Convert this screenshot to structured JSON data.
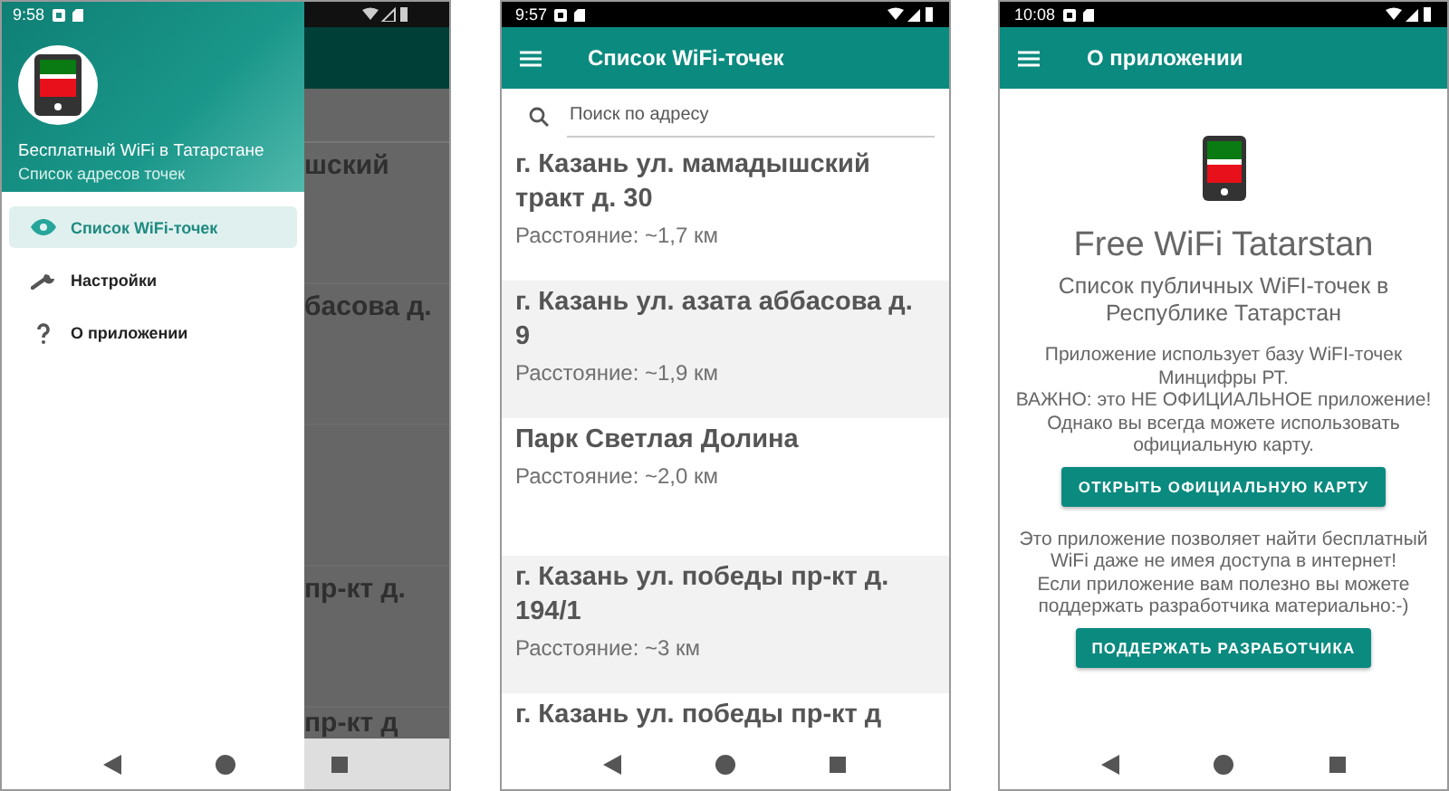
{
  "drawer_screen": {
    "status_time": "9:58",
    "drawer": {
      "title": "Бесплатный WiFi в Татарстане",
      "subtitle": "Список адресов точек",
      "items": [
        {
          "kind": "eye",
          "label": "Список WiFi-точек",
          "selected": true
        },
        {
          "kind": "wrench",
          "label": "Настройки",
          "selected": false
        },
        {
          "kind": "help",
          "label": "О приложении",
          "selected": false
        }
      ]
    },
    "background_fragments": [
      "шский",
      "басова д.",
      "пр-кт д.",
      "пр-кт д"
    ]
  },
  "list_screen": {
    "status_time": "9:57",
    "title": "Список WiFi-точек",
    "search": {
      "placeholder": "Поиск по адресу"
    },
    "items": [
      {
        "name": "г. Казань ул. мамадышский тракт д. 30",
        "distance": "Расстояние: ~1,7 км"
      },
      {
        "name": "г. Казань ул. азата аббасова д. 9",
        "distance": "Расстояние: ~1,9 км"
      },
      {
        "name": "Парк Светлая Долина",
        "distance": "Расстояние: ~2,0 км"
      },
      {
        "name": "г. Казань ул. победы пр-кт д. 194/1",
        "distance": "Расстояние: ~3 км"
      },
      {
        "name": "г. Казань ул. победы пр-кт д"
      }
    ]
  },
  "about_screen": {
    "status_time": "10:08",
    "title": "О приложении",
    "app_name": "Free WiFi Tatarstan",
    "subtitle": "Список публичных WiFI-точек в Республике Татарстан",
    "paragraphs_1": [
      "Приложение использует базу WiFI-точек Минцифры РТ.",
      "ВАЖНО: это НЕ ОФИЦИАЛЬНОЕ приложение!",
      "Однако вы всегда можете использовать официальную карту."
    ],
    "button_1": "ОТКРЫТЬ ОФИЦИАЛЬНУЮ КАРТУ",
    "paragraphs_2": [
      "Это приложение позволяет найти бесплатный WiFi даже не имея доступа в интернет!",
      "Если приложение вам полезно вы можете поддержать разработчика материально:-)"
    ],
    "button_2": "ПОДДЕРЖАТЬ РАЗРАБОТЧИКА"
  }
}
